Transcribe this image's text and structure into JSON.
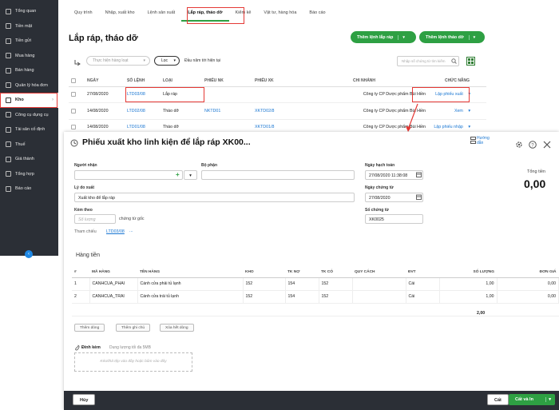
{
  "sidebar": {
    "items": [
      {
        "label": "Tổng quan",
        "chev": ""
      },
      {
        "label": "Tiền mặt",
        "chev": ""
      },
      {
        "label": "Tiền gửi",
        "chev": ""
      },
      {
        "label": "Mua hàng",
        "chev": ""
      },
      {
        "label": "Bán hàng",
        "chev": ""
      },
      {
        "label": "Quản lý hóa đơn",
        "chev": ""
      },
      {
        "label": "Kho",
        "chev": "›"
      },
      {
        "label": "Công cụ dụng cụ",
        "chev": ""
      },
      {
        "label": "Tài sản cố định",
        "chev": ""
      },
      {
        "label": "Thuế",
        "chev": ""
      },
      {
        "label": "Giá thành",
        "chev": ""
      },
      {
        "label": "Tổng hợp",
        "chev": ""
      },
      {
        "label": "Báo cáo",
        "chev": ""
      }
    ],
    "collapse": "‹"
  },
  "topnav": {
    "tabs": [
      "Quy trình",
      "Nhập, xuất kho",
      "Lệnh sản xuất",
      "Lắp ráp, tháo dỡ",
      "Kiểm kê",
      "Vật tư, hàng hóa",
      "Báo cáo"
    ]
  },
  "page": {
    "title": "Lắp ráp, tháo dỡ",
    "btn_assemble": "Thêm lệnh lắp ráp",
    "btn_disassemble": "Thêm lệnh tháo dỡ",
    "dd": "▾"
  },
  "filter": {
    "action_placeholder": "Thực hiện hàng loạt",
    "action_caret": "▾",
    "filter_btn": "Lọc",
    "filter_caret": "▾",
    "period": "Đầu năm tới hiện tại",
    "search_placeholder": "Nhập số chứng từ tìm kiếm"
  },
  "list": {
    "headers": [
      "NGÀY",
      "SỐ LỆNH",
      "LOẠI",
      "PHIẾU NK",
      "PHIẾU XK",
      "CHI NHÁNH",
      "CHỨC NĂNG"
    ],
    "rows": [
      {
        "date": "27/08/2020",
        "no": "LTD03/08",
        "type": "Lắp ráp",
        "nk": "",
        "xk": "",
        "branch": "Công ty CP Dược phẩm Bùi Hiền",
        "action": "Lập phiếu xuất",
        "caret": "▾"
      },
      {
        "date": "14/08/2020",
        "no": "LTD02/08",
        "type": "Tháo dỡ",
        "nk": "NKTD01",
        "xk": "XKTD02/8",
        "branch": "Công ty CP Dược phẩm Bùi Hiền",
        "action": "Xem",
        "caret": "▾"
      },
      {
        "date": "14/08/2020",
        "no": "LTD01/08",
        "type": "Tháo dỡ",
        "nk": "",
        "xk": "XKTD01/8",
        "branch": "Công ty CP Dược phẩm Bùi Hiền",
        "action": "Lập phiếu nhập",
        "caret": "▾"
      }
    ]
  },
  "dialog": {
    "title": "Phiếu xuất kho linh kiện để lắp ráp XK00...",
    "help": "Hướng dẫn",
    "recipient_label": "Người nhận",
    "dept_label": "Bộ phận",
    "reason_label": "Lý do xuất",
    "reason_value": "Xuất kho để lắp ráp",
    "attach_label": "Kèm theo",
    "attach_qty_placeholder": "Số lượng",
    "attach_suffix": "chứng từ gốc",
    "ref_label": "Tham chiếu",
    "ref_value": "LTD03/08",
    "ref_more": "...",
    "acc_date_label": "Ngày hạch toán",
    "acc_date": "27/08/2020 11:38:08",
    "doc_date_label": "Ngày chứng từ",
    "doc_date": "27/08/2020",
    "doc_no_label": "Số chứng từ",
    "doc_no": "XK0025",
    "total_label": "Tổng tiền",
    "total_value": "0,00",
    "plus": "+",
    "caret": "▾"
  },
  "detail": {
    "section": "Hàng tiền",
    "headers": [
      "#",
      "MÃ HÀNG",
      "TÊN HÀNG",
      "KHO",
      "TK NỢ",
      "TK CÓ",
      "QUY CÁCH",
      "ĐVT",
      "SỐ LƯỢNG",
      "ĐƠN GIÁ"
    ],
    "rows": [
      {
        "idx": "1",
        "code": "CANHCUA_PHAI",
        "name": "Cánh cửa phải tủ lạnh",
        "wh": "152",
        "debit": "154",
        "credit": "152",
        "spec": "",
        "unit": "Cái",
        "qty": "1,00",
        "price": "0,00"
      },
      {
        "idx": "2",
        "code": "CANHCUA_TRAI",
        "name": "Cánh cửa trái tủ lạnh",
        "wh": "152",
        "debit": "154",
        "credit": "152",
        "spec": "",
        "unit": "Cái",
        "qty": "1,00",
        "price": "0,00"
      }
    ],
    "qty_total": "2,00",
    "btn_add_row": "Thêm dòng",
    "btn_add_note": "Thêm ghi chú",
    "btn_clear": "Xóa hết dòng",
    "attach_title": "Đính kèm",
    "attach_hint": "Dung lượng tối đa 5MB",
    "drop_hint": "Kéo/thả tệp vào đây hoặc bấm vào đây"
  },
  "footer": {
    "cancel": "Hủy",
    "save": "Cất",
    "save_print": "Cất và In",
    "caret": "▾"
  }
}
